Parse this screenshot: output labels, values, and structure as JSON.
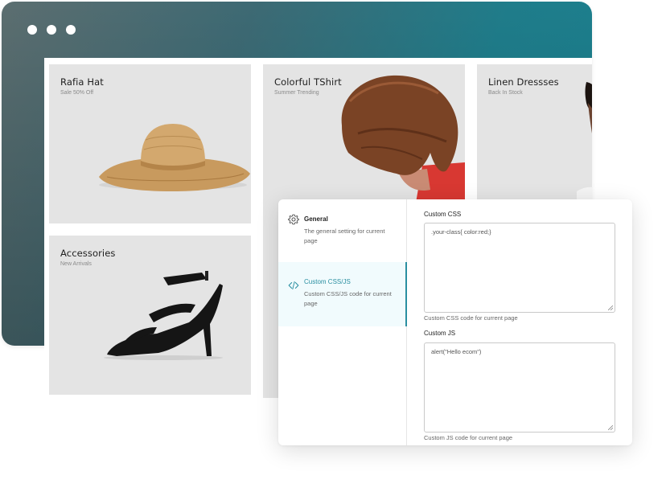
{
  "window": {
    "controls": [
      "dot",
      "dot",
      "dot"
    ]
  },
  "products": [
    {
      "title": "Rafia Hat",
      "subtitle": "Sale 50% Off"
    },
    {
      "title": "Colorful TShirt",
      "subtitle": "Summer Trending"
    },
    {
      "title": "Linen Dressses",
      "subtitle": "Back In Stock"
    },
    {
      "title": "Accessories",
      "subtitle": "New Arrivals"
    }
  ],
  "settings": {
    "nav": [
      {
        "icon": "gear-icon",
        "title": "General",
        "description": "The general setting for current page"
      },
      {
        "icon": "code-icon",
        "title": "Custom CSS/JS",
        "description": "Custom CSS/JS code for current page"
      }
    ],
    "css": {
      "label": "Custom CSS",
      "value": ".your-class{ color:red;}",
      "help": "Custom CSS code for current page"
    },
    "js": {
      "label": "Custom JS",
      "value": "alert(\"Hello ecom\")",
      "help": "Custom JS code for current page"
    }
  },
  "colors": {
    "accent": "#2a8fa1",
    "frame_gradient_start": "#5c6e70",
    "frame_gradient_end": "#1a8190"
  }
}
